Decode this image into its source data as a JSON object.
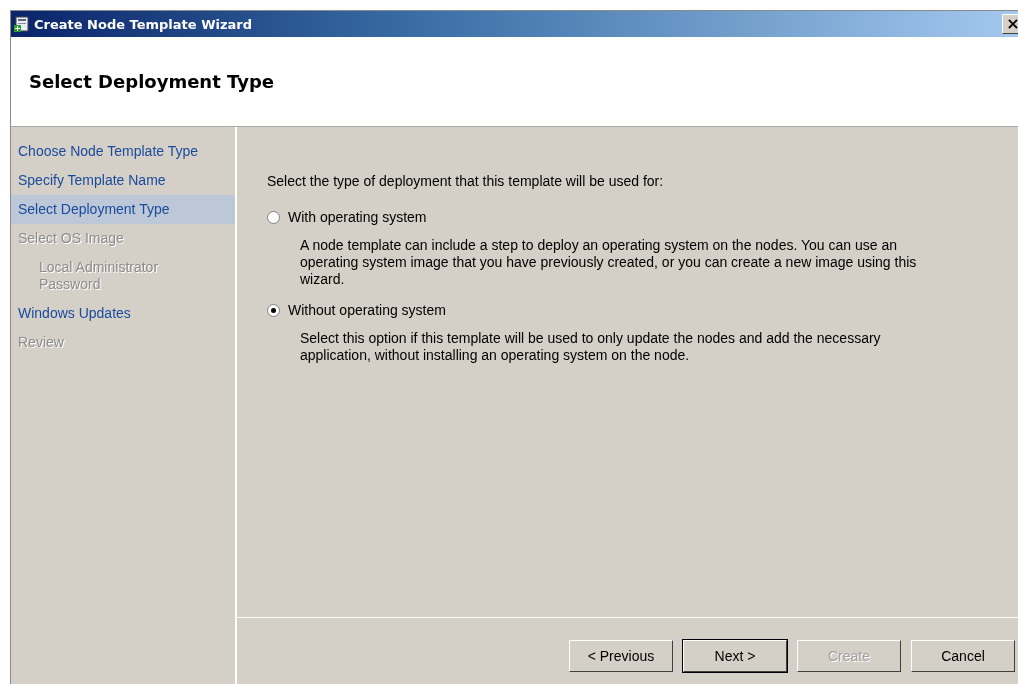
{
  "window": {
    "title": "Create Node Template Wizard",
    "close": "×"
  },
  "header": {
    "title": "Select Deployment Type"
  },
  "sidebar": {
    "items": [
      {
        "label": "Choose Node Template Type",
        "selected": false,
        "disabled": false
      },
      {
        "label": "Specify Template Name",
        "selected": false,
        "disabled": false
      },
      {
        "label": "Select Deployment Type",
        "selected": true,
        "disabled": false
      },
      {
        "label": "Select OS Image",
        "selected": false,
        "disabled": true,
        "children": [
          {
            "label": "Local Administrator Password",
            "selected": false,
            "disabled": true
          }
        ]
      },
      {
        "label": "Windows Updates",
        "selected": false,
        "disabled": false
      },
      {
        "label": "Review",
        "selected": false,
        "disabled": true
      }
    ]
  },
  "content": {
    "prompt": "Select the type of deployment that this template will be used for:",
    "options": [
      {
        "label": "With operating system",
        "selected": false,
        "description": "A node template can include a step to deploy an operating system on the nodes. You can use an operating system image that you have previously created, or you can create a new image using this wizard."
      },
      {
        "label": "Without operating system",
        "selected": true,
        "description": "Select this option if this template will be used to only update the nodes and add the necessary application, without installing an operating system on the node."
      }
    ]
  },
  "buttons": [
    {
      "label": "< Previous",
      "disabled": false,
      "default": false
    },
    {
      "label": "Next >",
      "disabled": false,
      "default": true
    },
    {
      "label": "Create",
      "disabled": true,
      "default": false
    },
    {
      "label": "Cancel",
      "disabled": false,
      "default": false
    }
  ]
}
